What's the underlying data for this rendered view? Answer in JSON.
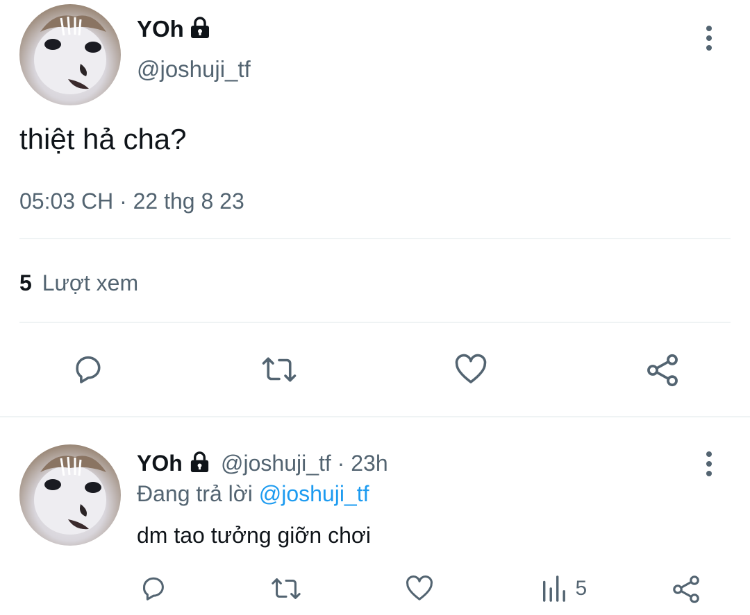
{
  "main_tweet": {
    "display_name": "YOh",
    "handle": "@joshuji_tf",
    "text": "thiệt hả cha?",
    "time": "05:03 CH",
    "separator": "·",
    "date": "22 thg 8 23",
    "views_count": "5",
    "views_label": "Lượt xem"
  },
  "reply_tweet": {
    "display_name": "YOh",
    "handle": "@joshuji_tf",
    "separator": "·",
    "age": "23h",
    "replying_prefix": "Đang trả lời",
    "replying_to": "@joshuji_tf",
    "text": "dm tao tưởng giỡn chơi",
    "views_count": "5"
  },
  "icons": {
    "lock": "lock-icon",
    "more": "more-vertical-icon",
    "reply": "reply-icon",
    "retweet": "retweet-icon",
    "like": "like-icon",
    "share": "share-icon",
    "views": "views-icon"
  },
  "colors": {
    "text": "#0f1419",
    "muted": "#536471",
    "link": "#1d9bf0",
    "divider": "#eff3f4"
  }
}
